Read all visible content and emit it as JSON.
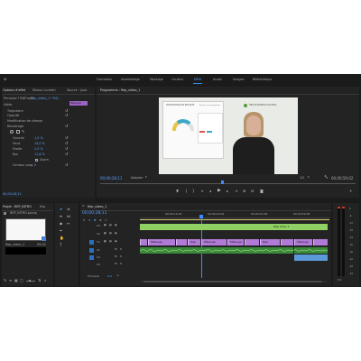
{
  "topnav": {
    "home_icon": "home-icon",
    "tabs": [
      "Formation",
      "Assemblage",
      "Montage",
      "Couleur",
      "Effet",
      "Audio",
      "Images",
      "Bibliothèque"
    ],
    "active_tab": "Effet"
  },
  "effect_controls": {
    "tabs": [
      "Options d'effet",
      "Mixeur Lumetri",
      "Source : (pas"
    ],
    "header_source": "Principal * RDP.mp4",
    "header_clip": "Rep_video_1 * RD...",
    "clip_label": "Mélange",
    "section_video": "Vidéo",
    "items": [
      "Trajectoire",
      "Opacité",
      "Modification de vitesse",
      "Recadrage"
    ],
    "params": [
      {
        "label": "Gauche",
        "value": "1,0 %"
      },
      {
        "label": "Haut",
        "value": "14,0 %"
      },
      {
        "label": "Droite",
        "value": "2,0 %"
      },
      {
        "label": "Bas",
        "value": "11,6 %"
      }
    ],
    "zoom_label": "Zoom",
    "contour_label": "Contour prog.",
    "contour_value": "0",
    "timecode": "00;00;28;11"
  },
  "program_monitor": {
    "title": "Programme : Rep_video_1",
    "timecode_current": "00;00;28;11",
    "fit": "Adapter",
    "quality": "1/2",
    "timecode_duration": "00;00;59;02",
    "video": {
      "slide_title": "POURCENTAGE DE RÉUSSITE",
      "slide_subtitle": "Réussir vos démarches",
      "logo_text": "NEW BUSINESS SUCCESS"
    }
  },
  "project": {
    "tabs": [
      "Projet : REP_INTRO",
      "Exp"
    ],
    "bin_path": "REP_INTRO.prproj",
    "item_name": "Rep_video_1",
    "item_duration": "59;02"
  },
  "timeline": {
    "sequence_name": "Rep_video_1",
    "timecode": "00;00;28;11",
    "ruler": [
      "00;00;14;29",
      "00;00;29;29",
      "00;00;44;28",
      "00;00;59;28"
    ],
    "video_tracks": [
      "V3",
      "V2",
      "V1"
    ],
    "audio_tracks": [
      "A1",
      "A2",
      "A3"
    ],
    "master_label": "Principal",
    "master_value": "0,0",
    "green_clip": "Rep video 1",
    "v1_clip_label": "Mélange",
    "v1_clip_short": "Rep"
  },
  "meters": {
    "labels": [
      "0",
      "-6",
      "-12",
      "-18",
      "-24",
      "-30",
      "-36",
      "-42",
      "-48",
      "-54"
    ],
    "footer": "S S"
  },
  "colors": {
    "accent_blue": "#2d8ceb",
    "video_clip": "#b07ad6",
    "adjustment_clip": "#8fd163",
    "audio_clip": "#3a8a3a",
    "playhead": "#3d8cff"
  }
}
